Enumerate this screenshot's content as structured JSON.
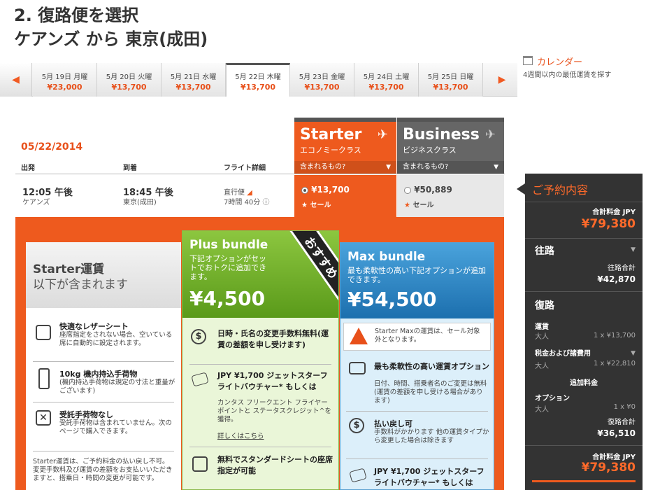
{
  "header": {
    "title_line1": "2. 復路便を選択",
    "title_line2": "ケアンズ から 東京(成田)"
  },
  "date_strip": {
    "dates": [
      {
        "date": "5月 19日 月曜",
        "price": "¥23,000"
      },
      {
        "date": "5月 20日 火曜",
        "price": "¥13,700"
      },
      {
        "date": "5月 21日 水曜",
        "price": "¥13,700"
      },
      {
        "date": "5月 22日 木曜",
        "price": "¥13,700"
      },
      {
        "date": "5月 23日 金曜",
        "price": "¥13,700"
      },
      {
        "date": "5月 24日 土曜",
        "price": "¥13,700"
      },
      {
        "date": "5月 25日 日曜",
        "price": "¥13,700"
      }
    ],
    "selected_index": 3
  },
  "calendar": {
    "label": "カレンダー",
    "sub": "4週間以内の最低運賃を探す"
  },
  "fare_classes": {
    "starter": {
      "name": "Starter",
      "sub": "エコノミークラス",
      "included": "含まれるもの?"
    },
    "business": {
      "name": "Business",
      "sub": "ビジネスクラス",
      "included": "含まれるもの?"
    }
  },
  "flight_table": {
    "date": "05/22/2014",
    "col_depart": "出発",
    "col_arrive": "到着",
    "col_details": "フライト詳細",
    "depart_time": "12:05 午後",
    "depart_city": "ケアンズ",
    "arrive_time": "18:45 午後",
    "arrive_city": "東京(成田)",
    "flight_type": "直行便",
    "duration": "7時間 40分",
    "starter_price": "¥13,700",
    "starter_sale": "セール",
    "business_price": "¥50,889",
    "business_sale": "セール"
  },
  "starter_card": {
    "title1": "Starter運賃",
    "title2": "以下が含まれます",
    "features": [
      {
        "title": "快適なレザーシート",
        "desc": "座席指定をされない場合、空いている席に自動的に設定されます。"
      },
      {
        "title": "10kg 機内持込手荷物",
        "desc": "(機内持込手荷物は規定の寸法と重量がございます)"
      },
      {
        "title": "受託手荷物なし",
        "desc": "受託手荷物は含まれていません。次のページで購入できます。"
      }
    ],
    "note": "Starter運賃は、ご予約料金の払い戻し不可。変更手数料及び運賃の差額をお支払いいただきますと、搭乗日・時間の変更が可能です。"
  },
  "plus_bundle": {
    "title": "Plus bundle",
    "sub": "下記オプションがセットでおトクに追加できます。",
    "price": "¥4,500",
    "ribbon": "おすすめ",
    "features": [
      {
        "title": "日時・氏名の変更手数料無料(運賃の差額を申し受けます)"
      },
      {
        "title": "JPY ¥1,700 ジェットスターフライトバウチャー* もしくは",
        "desc": "カンタス フリークエント フライヤー ポイントと ステータスクレジット^を獲得。",
        "link": "詳しくはこちら"
      },
      {
        "title": "無料でスタンダードシートの座席指定が可能"
      }
    ]
  },
  "max_bundle": {
    "title": "Max bundle",
    "sub": "最も柔軟性の高い下記オプションが追加できます。",
    "price": "¥54,500",
    "warning": "Starter Maxの運賃は、セール対象外となります。",
    "features": [
      {
        "title": "最も柔軟性の高い運賃オプション",
        "desc": "日付、時間、搭乗者名のご変更は無料(運賃の差額を申し受ける場合があります)"
      },
      {
        "title": "払い戻し可",
        "desc": "手数料がかかります 他の運賃タイプから変更した場合は除きます"
      },
      {
        "title": "JPY ¥1,700 ジェットスターフライトバウチャー* もしくは"
      }
    ]
  },
  "summary": {
    "title": "ご予約内容",
    "total_label": "合計料金 JPY",
    "total": "¥79,380",
    "outbound_label": "往路",
    "outbound_sub": "往路合計",
    "outbound_total": "¥42,870",
    "return_label": "復路",
    "fare_label": "運賃",
    "adult": "大人",
    "fare_value": "1 x ¥13,700",
    "tax_label": "税金および諸費用",
    "tax_value": "1 x ¥22,810",
    "extra_label": "追加料金",
    "option_label": "オプション",
    "option_value": "1 x ¥0",
    "return_sub": "復路合計",
    "return_total": "¥36,510",
    "total_label2": "合計料金 JPY",
    "total2": "¥79,380"
  },
  "colors": {
    "accent": "#ee5a1e",
    "plus": "#6aaa2a",
    "max": "#2a82c4",
    "sidebar": "#333333"
  }
}
